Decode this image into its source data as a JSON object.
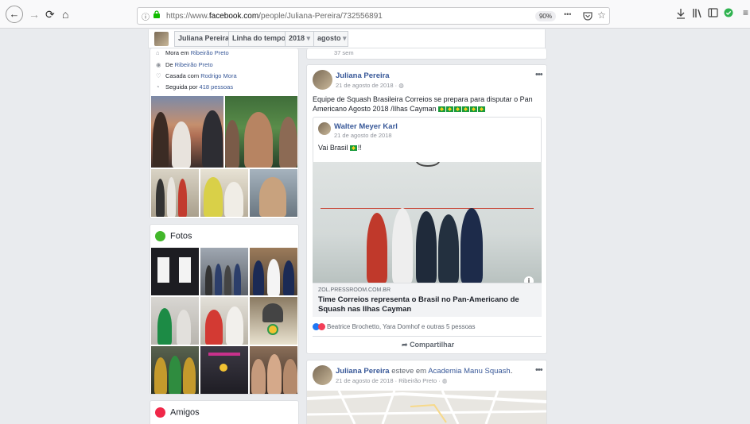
{
  "browser": {
    "url_prefix": "https://www.",
    "url_domain": "facebook.com",
    "url_path": "/people/Juliana-Pereira/732556891",
    "zoom": "90%",
    "more": "•••"
  },
  "nav": {
    "name": "Juliana Pereira",
    "timeline": "Linha do tempo",
    "year": "2018",
    "month": "agosto"
  },
  "intro": {
    "lives_prefix": "Mora em ",
    "lives_city": "Ribeirão Preto",
    "from_prefix": "De ",
    "from_city": "Ribeirão Preto",
    "married_prefix": "Casada com ",
    "married_name": "Rodrigo Mora",
    "followed_prefix": "Seguida por ",
    "followed_count": "418 pessoas"
  },
  "sections": {
    "photos": "Fotos",
    "friends": "Amigos"
  },
  "prev_post": {
    "time": "37 sem"
  },
  "post1": {
    "author": "Juliana Pereira",
    "date": "21 de agosto de 2018 · ",
    "text_line1": "Equipe de Squash Brasileira Correios se prepara para disputar o Pan",
    "text_line2": "Americano Agosto 2018 /Ilhas Cayman ",
    "shared": {
      "author": "Walter Meyer Karl",
      "date": "21 de agosto de 2018",
      "text": "Vai Brasil ",
      "text_suffix": "!!"
    },
    "link": {
      "domain": "ZOL.PRESSROOM.COM.BR",
      "title_line1": "Time Correios representa o Brasil no Pan-Americano de",
      "title_line2": "Squash nas Ilhas Cayman"
    },
    "reactions": "Beatrice Brochetto, Yara Domhof e outras 5 pessoas",
    "share": "Compartilhar"
  },
  "post2": {
    "author": "Juliana Pereira",
    "action": " esteve em ",
    "place": "Academia Manu Squash",
    "action_end": ".",
    "date": "21 de agosto de 2018 · Ribeirão Preto · "
  },
  "colors": {
    "fb_blue": "#385898",
    "photos_icon": "#42b72a",
    "friends_icon": "#f02849",
    "brazil_green": "#1a9b3c",
    "brazil_yellow": "#f4d11c"
  }
}
